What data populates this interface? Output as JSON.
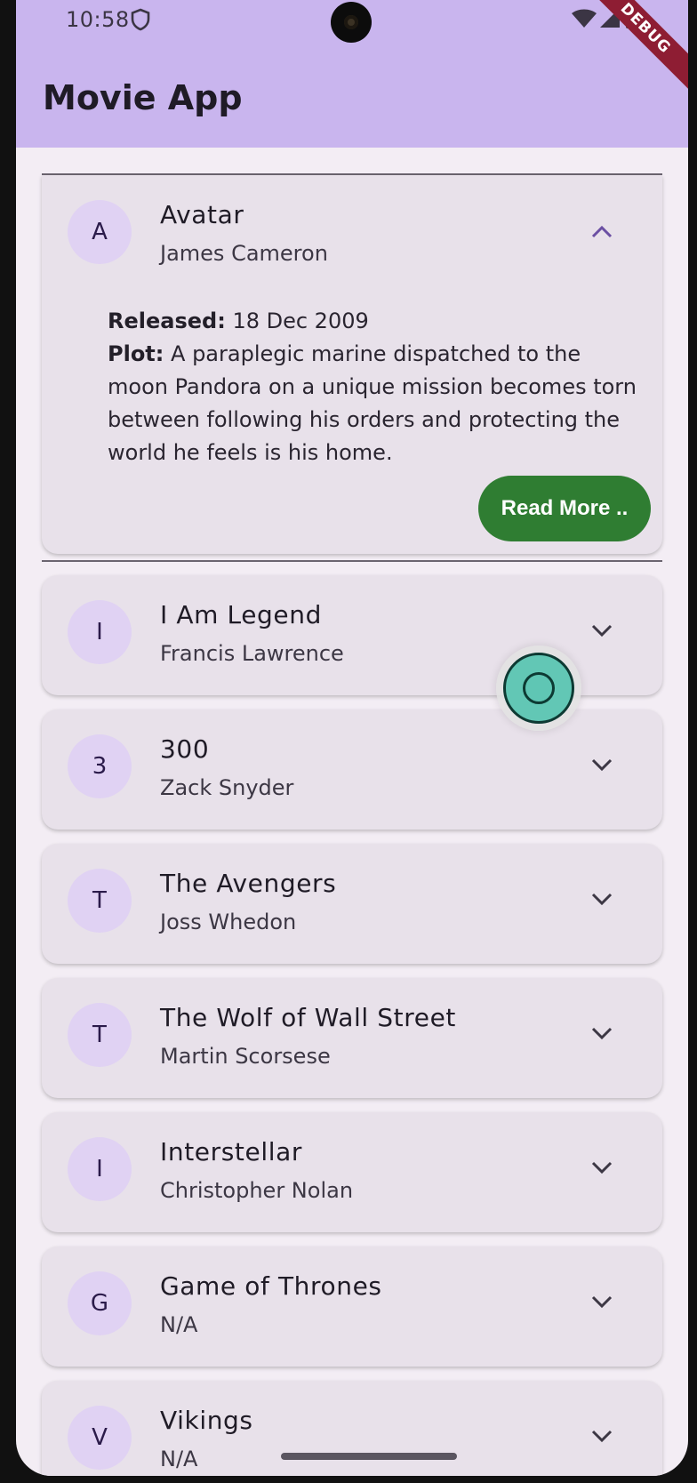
{
  "status_bar": {
    "time": "10:58"
  },
  "debug_banner": "DEBUG",
  "app_bar": {
    "title": "Movie App"
  },
  "movies": [
    {
      "initial": "A",
      "title": "Avatar",
      "director": "James Cameron",
      "expanded": true
    },
    {
      "initial": "I",
      "title": "I Am Legend",
      "director": "Francis Lawrence",
      "expanded": false
    },
    {
      "initial": "3",
      "title": "300",
      "director": "Zack Snyder",
      "expanded": false
    },
    {
      "initial": "T",
      "title": "The Avengers",
      "director": "Joss Whedon",
      "expanded": false
    },
    {
      "initial": "T",
      "title": "The Wolf of Wall Street",
      "director": "Martin Scorsese",
      "expanded": false
    },
    {
      "initial": "I",
      "title": "Interstellar",
      "director": "Christopher Nolan",
      "expanded": false
    },
    {
      "initial": "G",
      "title": "Game of Thrones",
      "director": "N/A",
      "expanded": false
    },
    {
      "initial": "V",
      "title": "Vikings",
      "director": "N/A",
      "expanded": false
    }
  ],
  "expanded_details": {
    "released_label": "Released:",
    "released_value": "18 Dec 2009",
    "plot_label": "Plot:",
    "plot_value": "A paraplegic marine dispatched to the moon Pandora on a unique mission becomes torn between following his orders and protecting the world he feels is his home.",
    "read_more_label": "Read More .."
  },
  "colors": {
    "app_bar": "#c9b5ee",
    "background": "#f3edf4",
    "card": "#e8e1ea",
    "avatar": "#e0d2f3",
    "read_more_button": "#2f7d32",
    "debug_banner": "#8e1d33",
    "floating_button": "#62c7b5"
  }
}
